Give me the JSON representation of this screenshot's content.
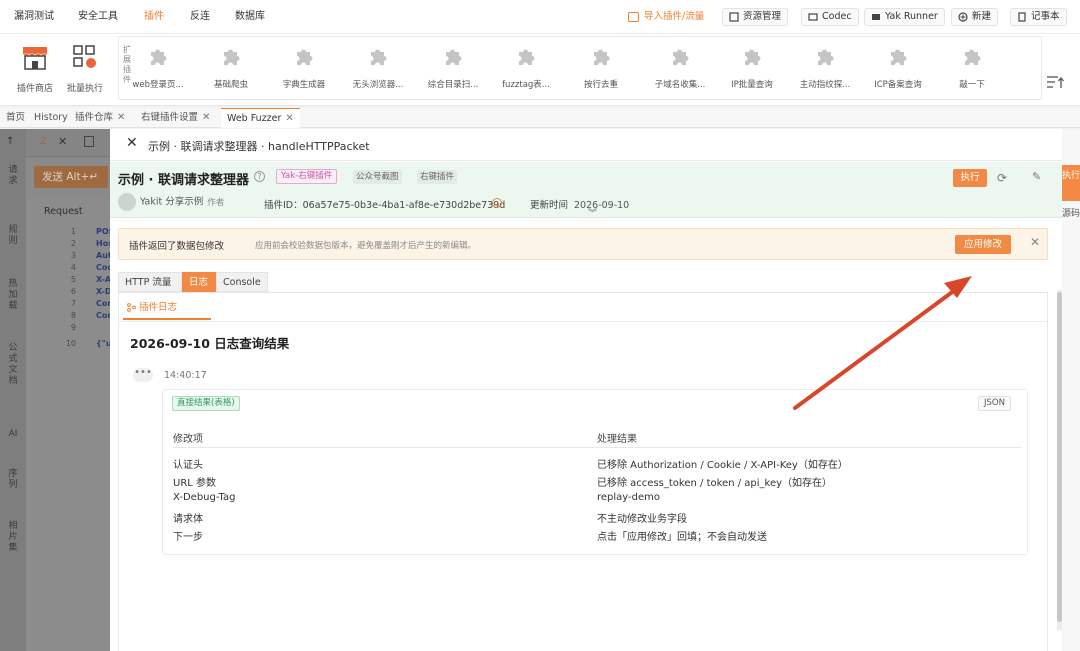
{
  "topnav": {
    "menus": [
      "漏洞测试",
      "安全工具",
      "插件",
      "反连",
      "数据库"
    ],
    "active_menu": "插件",
    "import_label": "导入插件/流量",
    "buttons": [
      {
        "label": "资源管理",
        "icon": "resource-icon"
      },
      {
        "label": "Codec",
        "icon": "codec-icon"
      },
      {
        "label": "Yak Runner",
        "icon": "yak-runner-icon"
      },
      {
        "label": "新建",
        "icon": "new-icon"
      },
      {
        "label": "记事本",
        "icon": "notepad-icon"
      }
    ]
  },
  "toolbar": {
    "store_label": "插件商店",
    "batch_label": "批量执行",
    "panel_label": "扩展插件",
    "plugins": [
      "web登录页...",
      "基础爬虫",
      "字典生成器",
      "无头浏览器...",
      "综合目录扫...",
      "fuzztag表...",
      "按行去重",
      "子域名收集...",
      "IP批量查询",
      "主动指纹探...",
      "ICP备案查询",
      "敲一下"
    ]
  },
  "tabs": [
    {
      "label": "首页",
      "closable": false
    },
    {
      "label": "History",
      "closable": false
    },
    {
      "label": "插件仓库",
      "closable": true
    },
    {
      "label": "右键插件设置",
      "closable": true
    },
    {
      "label": "Web Fuzzer",
      "closable": true,
      "active": true
    }
  ],
  "left": {
    "side_labels": [
      "请求",
      "规则",
      "热加载",
      "公式文档",
      "AI",
      "序列",
      "相片集"
    ],
    "send_button": "发送 Alt+↵",
    "request_title": "Request",
    "lines": [
      {
        "n": "1",
        "code": "POS"
      },
      {
        "n": "2",
        "code": "Hos"
      },
      {
        "n": "3",
        "code": "Aut"
      },
      {
        "n": "4",
        "code": "Coo"
      },
      {
        "n": "5",
        "code": "X-A"
      },
      {
        "n": "6",
        "code": "X-D"
      },
      {
        "n": "7",
        "code": "Con"
      },
      {
        "n": "8",
        "code": "Con"
      },
      {
        "n": "9",
        "code": ""
      },
      {
        "n": "10",
        "code": "{\"u"
      }
    ]
  },
  "modal": {
    "header_title": "示例 · 联调请求整理器 · handleHTTPPacket",
    "plugin_name": "示例 · 联调请求整理器",
    "tags": [
      "Yak-右键插件",
      "公众号截图",
      "右键插件"
    ],
    "author": "Yakit 分享示例",
    "author_role": "作者",
    "plugin_id_label": "插件ID：",
    "plugin_id": "06a57e75-0b3e-4ba1-af8e-e730d2be739d",
    "updated_label": "更新时间",
    "updated_value": "2026-09-10",
    "run_button": "执行",
    "warning_title": "插件返回了数据包修改",
    "warning_desc": "应用前会校验数据包版本，避免覆盖刚才后产生的新编辑。",
    "apply_button": "应用修改",
    "subtabs": [
      "HTTP 流量",
      "日志",
      "Console"
    ],
    "active_subtab": "日志",
    "log_tab": "插件日志",
    "log_title": "2026-09-10 日志查询结果",
    "log_time": "14:40:17",
    "result_tag": "直接结果(表格)",
    "json_button": "JSON",
    "columns": [
      "修改项",
      "处理结果"
    ],
    "rows": [
      [
        "认证头",
        "已移除 Authorization / Cookie / X-API-Key（如存在）"
      ],
      [
        "URL 参数",
        "已移除 access_token / token / api_key（如存在）"
      ],
      [
        "X-Debug-Tag",
        "replay-demo"
      ],
      [
        "请求体",
        "不主动修改业务字段"
      ],
      [
        "下一步",
        "点击「应用修改」回填；不会自动发送"
      ]
    ]
  },
  "right_side": {
    "run": "执行",
    "source": "源码"
  },
  "colors": {
    "accent": "#f28a46",
    "arrow": "#d9472b",
    "plugin_bar_bg": "#ebf7ef",
    "warning_bg": "#fdf4e8"
  }
}
